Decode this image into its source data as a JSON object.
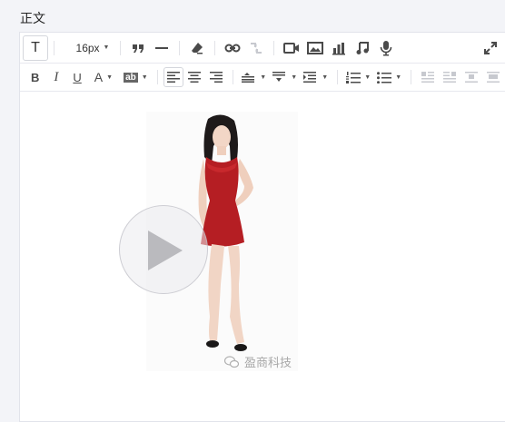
{
  "field_label": "正文",
  "toolbar": {
    "text_style_btn": "T",
    "font_size": "16px",
    "bold": "B",
    "italic": "I",
    "underline": "U",
    "font_color": "A",
    "background_color": "ab"
  },
  "video": {
    "watermark_text": "盈商科技"
  }
}
